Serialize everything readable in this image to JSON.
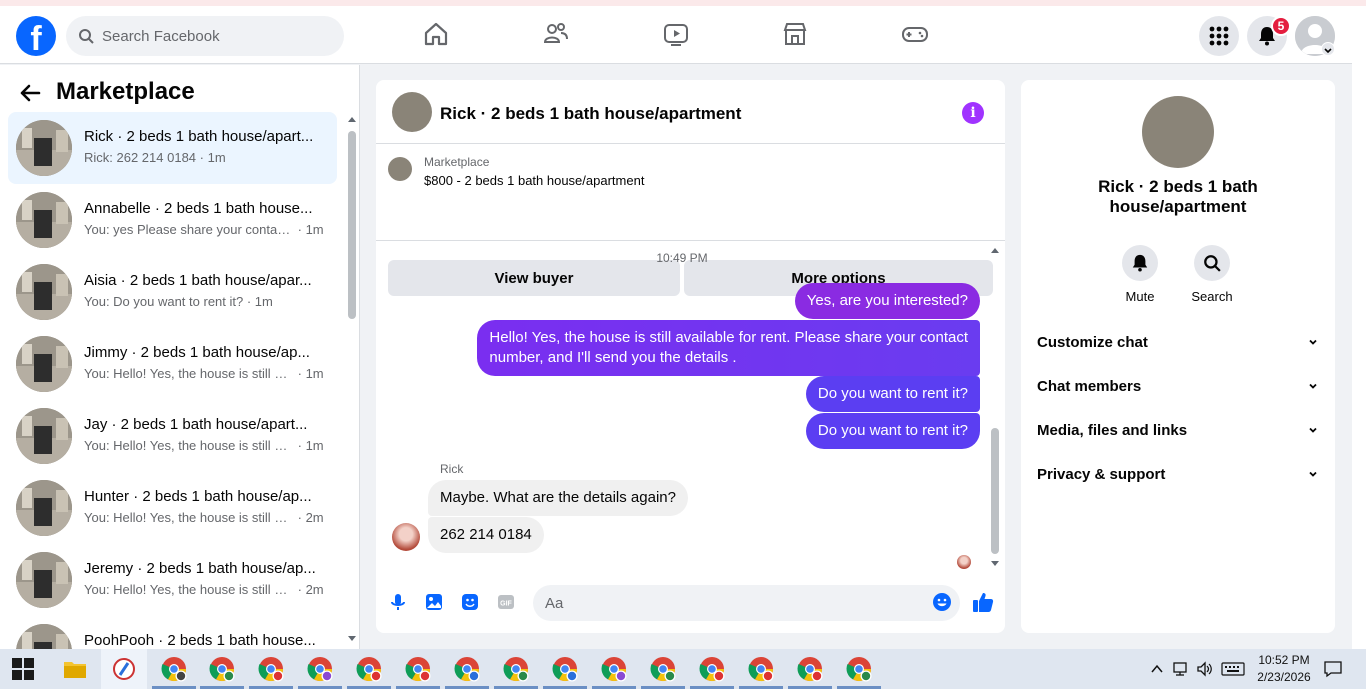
{
  "topbar": {
    "search_placeholder": "Search Facebook",
    "notification_count": "5"
  },
  "sidebar": {
    "title": "Marketplace",
    "conversations": [
      {
        "name": "Rick · 2 beds 1 bath house/apart...",
        "preview": "Rick: 262 214 0184",
        "time": "1m",
        "active": true
      },
      {
        "name": "Annabelle · 2 beds 1 bath house...",
        "preview": "You: yes Please share your contact ...",
        "time": "1m"
      },
      {
        "name": "Aisia · 2 beds 1 bath house/apar...",
        "preview": "You: Do you want to rent it?",
        "time": "1m"
      },
      {
        "name": "Jimmy · 2 beds 1 bath house/ap...",
        "preview": "You: Hello! Yes, the house is still av...",
        "time": "1m"
      },
      {
        "name": "Jay · 2 beds 1 bath house/apart...",
        "preview": "You: Hello! Yes, the house is still av...",
        "time": "1m"
      },
      {
        "name": "Hunter · 2 beds 1 bath house/ap...",
        "preview": "You: Hello! Yes, the house is still av...",
        "time": "2m"
      },
      {
        "name": "Jeremy · 2 beds 1 bath house/ap...",
        "preview": "You: Hello! Yes, the house is still av...",
        "time": "2m"
      },
      {
        "name": "PoohPooh · 2 beds 1 bath house...",
        "preview": "",
        "time": ""
      }
    ]
  },
  "chat": {
    "title": "Rick · 2 beds 1 bath house/apartment",
    "marketplace_label": "Marketplace",
    "listing": "$800 - 2 beds 1 bath house/apartment",
    "view_buyer": "View buyer",
    "more_options": "More options",
    "timestamp": "10:49 PM",
    "messages": {
      "out1": "Yes, are you interested?",
      "out2_line1": "Hello! Yes, the house is still available for rent. Please share your contact",
      "out2_line2": "number, and I'll send you the details .",
      "out3": "Do you want to rent it?",
      "out4": "Do you want to rent it?",
      "sender": "Rick",
      "in1": "Maybe. What are the details again?",
      "in2": "262 214 0184"
    },
    "composer_placeholder": "Aa"
  },
  "info_panel": {
    "name": "Rick · 2 beds 1 bath house/apartment",
    "mute": "Mute",
    "search": "Search",
    "sections": [
      "Customize chat",
      "Chat members",
      "Media, files and links",
      "Privacy & support"
    ]
  },
  "taskbar": {
    "time": "10:52 PM",
    "date": "2/23/2026"
  },
  "colors": {
    "brand": "#0866ff",
    "outgoing_bubble": "#8a2be2",
    "notification_badge": "#e41e3f"
  }
}
